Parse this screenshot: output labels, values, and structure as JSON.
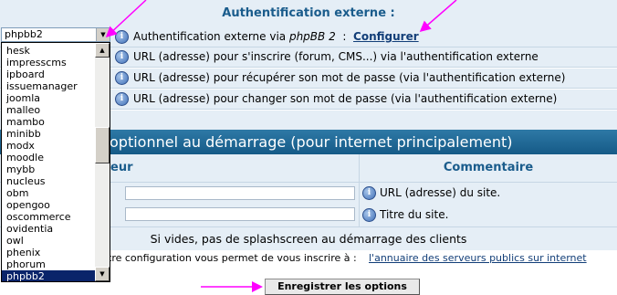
{
  "external_auth": {
    "header": "Authentification externe :",
    "rows": [
      {
        "prefix": "Authentification externe via ",
        "emphasis": "phpBB 2",
        "suffix": "  :  ",
        "link": "Configurer"
      },
      {
        "text": "URL (adresse) pour s'inscrire (forum, CMS...) via l'authentification externe"
      },
      {
        "text": "URL (adresse) pour récupérer son mot de passe (via l'authentification externe)"
      },
      {
        "text": "URL (adresse) pour changer son mot de passe (via l'authentification externe)"
      }
    ]
  },
  "splash": {
    "banner": "optionnel au démarrage (pour internet principalement)",
    "col_value": "eur",
    "col_comment": "Commentaire",
    "rows": [
      {
        "value": "",
        "comment": "URL (adresse) du site."
      },
      {
        "value": "",
        "comment": "Titre du site."
      }
    ],
    "note": "Si vides, pas de splashscreen au démarrage des clients",
    "footnote_prefix": "tre configuration vous permet de vous inscrire à : ",
    "footnote_link": "l'annuaire des serveurs publics sur internet"
  },
  "actions": {
    "save_label": "Enregistrer les options"
  },
  "auth_select": {
    "value": "phpbb2",
    "options": [
      "hesk",
      "impresscms",
      "ipboard",
      "issuemanager",
      "joomla",
      "malleo",
      "mambo",
      "minibb",
      "modx",
      "moodle",
      "mybb",
      "nucleus",
      "obm",
      "opengoo",
      "oscommerce",
      "ovidentia",
      "owl",
      "phenix",
      "phorum",
      "phpbb2"
    ],
    "selected_index": 19
  },
  "icons": {
    "info": "info-icon",
    "dropdown": "chevron-down-icon",
    "scroll_up": "arrow-up-icon",
    "scroll_down": "arrow-down-icon"
  },
  "colors": {
    "panel_bg": "#e5eef6",
    "header_text": "#1a5c8c",
    "banner": "#1f6b98",
    "link": "#123e78",
    "selection": "#0a246a",
    "annotation": "#ff00ff"
  }
}
